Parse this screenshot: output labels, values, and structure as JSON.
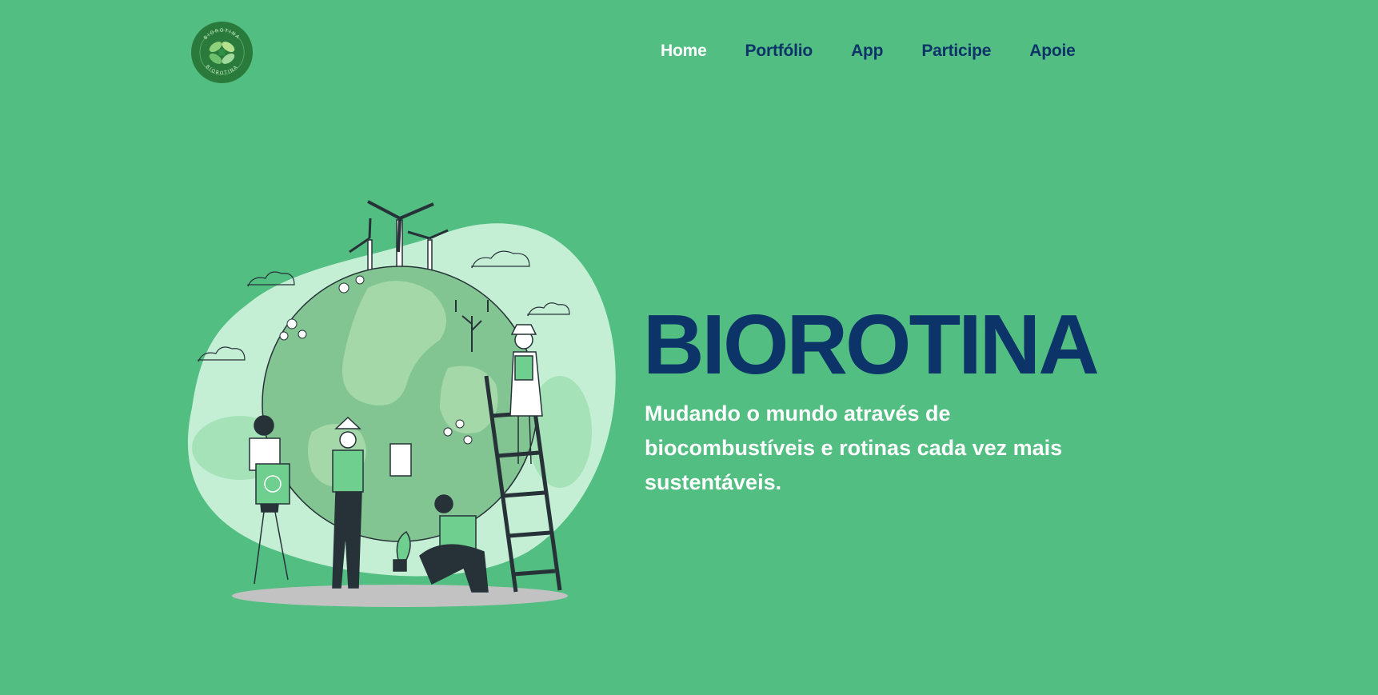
{
  "brand": {
    "logo_ring_text": "BIOROTINA",
    "logo_color": "#2a7a3b"
  },
  "nav": {
    "items": [
      {
        "label": "Home",
        "active": true
      },
      {
        "label": "Portfólio",
        "active": false
      },
      {
        "label": "App",
        "active": false
      },
      {
        "label": "Participe",
        "active": false
      },
      {
        "label": "Apoie",
        "active": false
      }
    ]
  },
  "hero": {
    "title": "BIOROTINA",
    "subtitle": "Mudando o mundo através de biocombustíveis e rotinas cada vez mais sustentáveis."
  },
  "colors": {
    "background": "#52be82",
    "navy": "#0c3468",
    "white": "#ffffff",
    "light_green": "#c5efd5",
    "globe_green": "#82c592",
    "dark": "#263238"
  },
  "illustration": {
    "icon": "eco-volunteers-globe-illustration"
  }
}
